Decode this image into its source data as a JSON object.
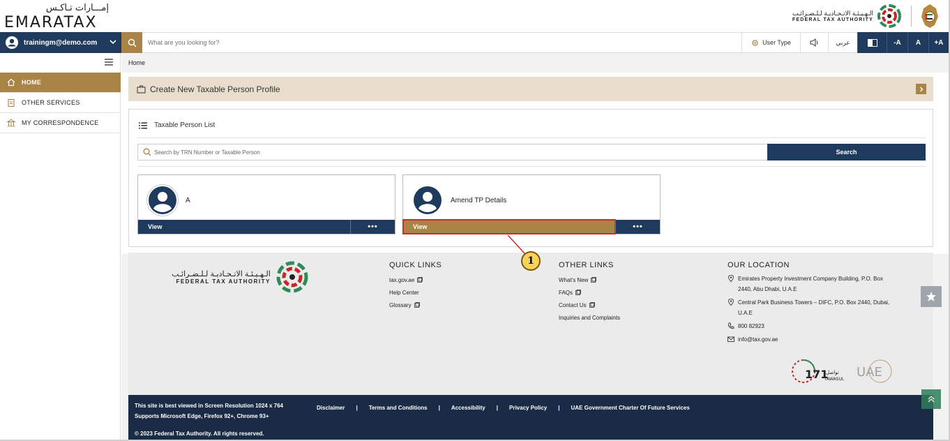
{
  "brand": {
    "app_name_ar": "إمـــارات تـاكـس",
    "app_name_en": "EMARATAX",
    "authority_ar": "الـهـيـئـة الاتـحـاديـة لـلـضـرائـب",
    "authority_en": "FEDERAL TAX AUTHORITY"
  },
  "topbar": {
    "user_email": "trainingm@demo.com",
    "search_placeholder": "What are you looking for?",
    "user_type_label": "User Type",
    "language_label": "عربي",
    "font_decrease": "-A",
    "font_normal": "A",
    "font_increase": "+A"
  },
  "sidebar": {
    "items": [
      {
        "label": "HOME",
        "icon": "home-icon",
        "active": true
      },
      {
        "label": "OTHER SERVICES",
        "icon": "clipboard-icon",
        "active": false
      },
      {
        "label": "MY CORRESPONDENCE",
        "icon": "building-icon",
        "active": false
      }
    ]
  },
  "breadcrumb": "Home",
  "create_profile": {
    "label": "Create New Taxable Person Profile"
  },
  "taxable_person_list": {
    "title": "Taxable Person List",
    "search_placeholder": "Search by TRN Number or Taxable Person",
    "search_button": "Search",
    "cards": [
      {
        "name": "A",
        "view_label": "View",
        "more_label": "•••"
      },
      {
        "name": "Amend TP Details",
        "view_label": "View",
        "more_label": "•••"
      }
    ]
  },
  "footer": {
    "quick_links": {
      "title": "QUICK LINKS",
      "items": [
        "tax.gov.ae",
        "Help Center",
        "Glossary"
      ]
    },
    "other_links": {
      "title": "OTHER LINKS",
      "items": [
        "What's New",
        "FAQs",
        "Contact Us",
        "Inquiries and Complaints"
      ]
    },
    "location": {
      "title": "OUR LOCATION",
      "address_1": "Emirates Property Investment Company Building, P.O. Box 2440, Abu Dhabi, U.A.E",
      "address_2": "Central Park Business Towers – DIFC, P.O. Box 2440, Dubai, U.A.E",
      "phone": "800 82923",
      "email": "info@tax.gov.ae"
    },
    "tawasul_label": "TAWASUL",
    "tawasul_number": "171",
    "tawasul_ar": "تواصل",
    "uae_logo": "UAE"
  },
  "bottom_bar": {
    "resolution_note": "This site is best viewed in Screen Resolution 1024 x 764",
    "browser_note": "Supports Microsoft Edge, Firefox 92+, Chrome 93+",
    "links": [
      "Disclaimer",
      "Terms and Conditions",
      "Accessibility",
      "Privacy Policy",
      "UAE Government Charter Of Future Services"
    ],
    "copyright": "© 2023 Federal Tax Authority. All rights reserved."
  },
  "annotation": {
    "callout_number": "1"
  },
  "colors": {
    "navy": "#1e3a5c",
    "gold": "#a98446",
    "beige": "#e9decd",
    "highlight_red": "#d62828",
    "callout_yellow": "#f7d25c"
  }
}
